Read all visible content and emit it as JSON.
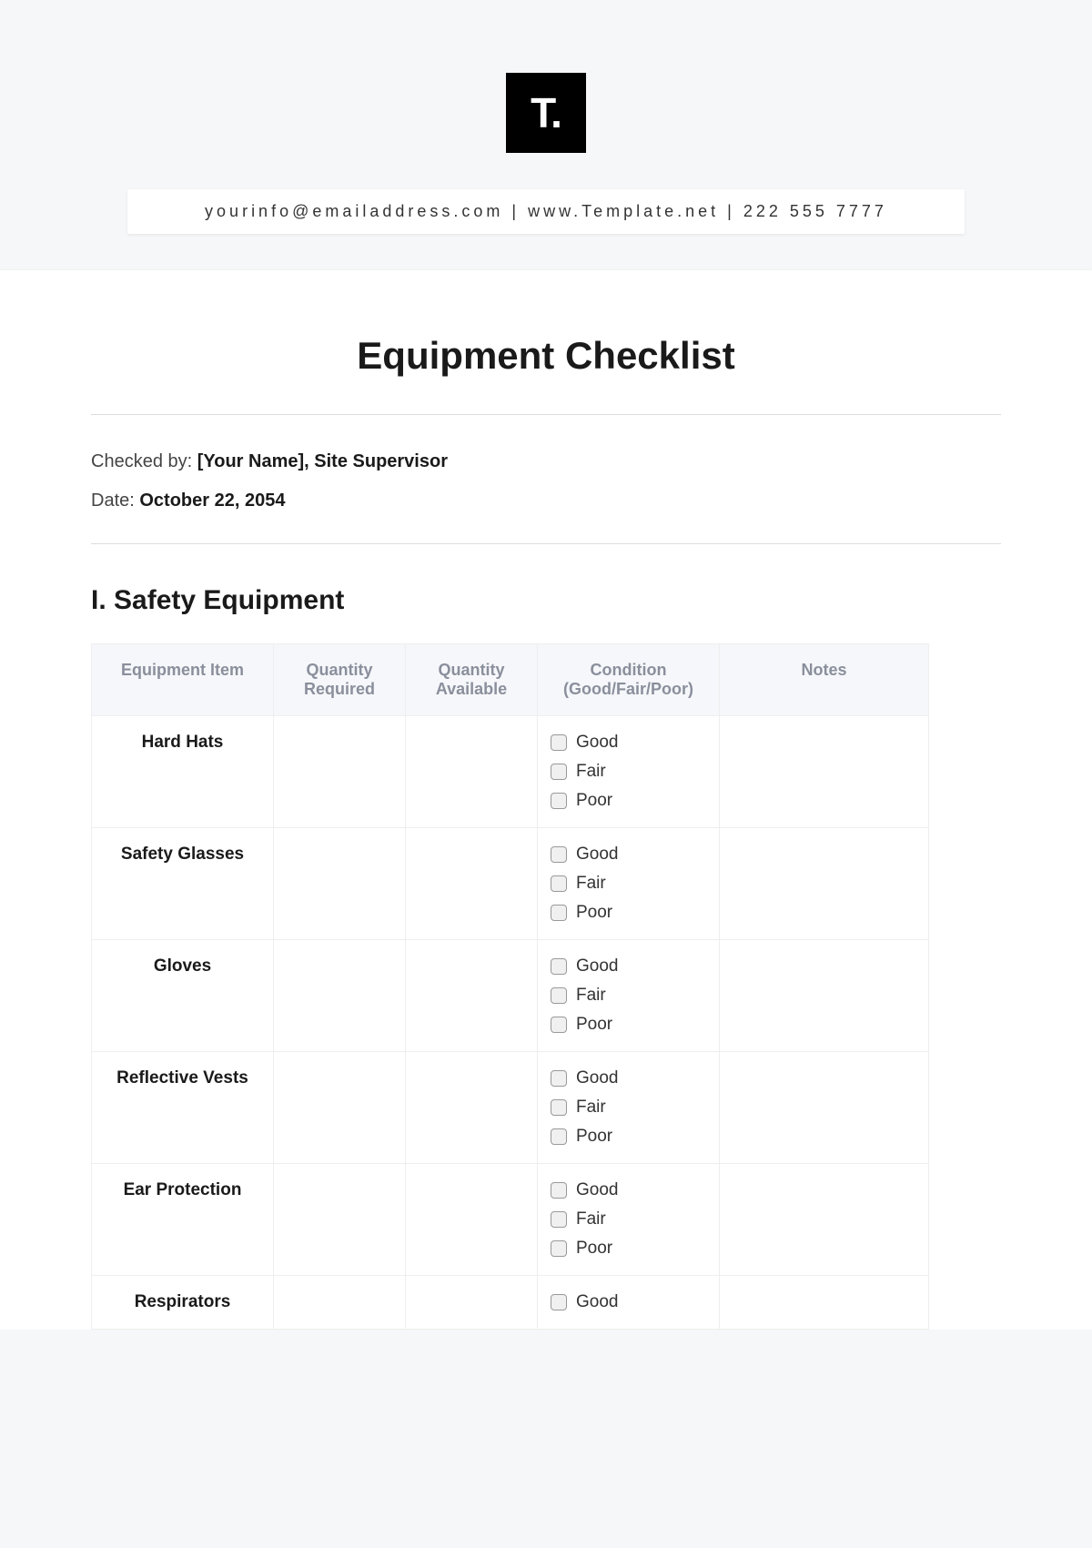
{
  "logo": "T.",
  "info_bar": "yourinfo@emailaddress.com | www.Template.net | 222 555 7777",
  "title": "Equipment Checklist",
  "checked_by_label": "Checked by: ",
  "checked_by_value": "[Your Name], Site Supervisor",
  "date_label": "Date: ",
  "date_value": "October 22, 2054",
  "section_heading": "I. Safety Equipment",
  "table": {
    "headers": {
      "item": "Equipment Item",
      "req": "Quantity Required",
      "avail": "Quantity Available",
      "cond": "Condition (Good/Fair/Poor)",
      "notes": "Notes"
    },
    "conditions": {
      "good": "Good",
      "fair": "Fair",
      "poor": "Poor"
    },
    "rows": [
      {
        "item": "Hard Hats"
      },
      {
        "item": "Safety Glasses"
      },
      {
        "item": "Gloves"
      },
      {
        "item": "Reflective Vests"
      },
      {
        "item": "Ear Protection"
      },
      {
        "item": "Respirators"
      }
    ]
  }
}
